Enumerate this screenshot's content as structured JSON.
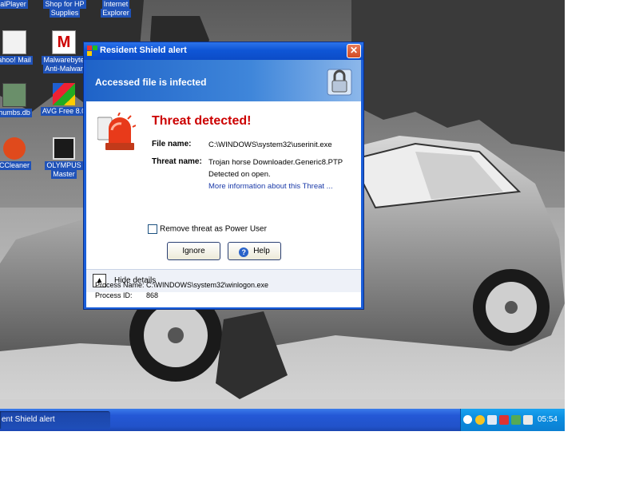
{
  "desktop": {
    "icons": [
      {
        "label": "ealPlayer"
      },
      {
        "label": "Shop for HP"
      },
      {
        "label": "Supplies"
      },
      {
        "label": "Internet"
      },
      {
        "label": "Explorer"
      },
      {
        "label": "ahoo! Mail"
      },
      {
        "label": "Malwarebyte"
      },
      {
        "label": "Anti-Malwar"
      },
      {
        "label": "humbs.db"
      },
      {
        "label": "AVG Free 8.0"
      },
      {
        "label": "CCleaner"
      },
      {
        "label": "OLYMPUS"
      },
      {
        "label": "Master"
      }
    ]
  },
  "taskbar": {
    "task_label": "ent Shield alert",
    "clock": "05:54"
  },
  "dialog": {
    "title": "Resident Shield alert",
    "banner": "Accessed file is infected",
    "threat_title": "Threat detected!",
    "file_name_label": "File name:",
    "file_name_value": "C:\\WINDOWS\\system32\\userinit.exe",
    "threat_name_label": "Threat name:",
    "threat_name_value": "Trojan horse Downloader.Generic8.PTP",
    "detected_text": "Detected on open.",
    "more_info_link": "More information about this Threat ...",
    "remove_checkbox_label": "Remove threat as Power User",
    "ignore_button": "Ignore",
    "help_button": "Help",
    "hide_details": "Hide details",
    "process_name_label": "Process Name:",
    "process_name_value": "C:\\WINDOWS\\system32\\winlogon.exe",
    "process_id_label": "Process ID:",
    "process_id_value": "868"
  },
  "colors": {
    "taskbar_blue": "#2458d6",
    "tray_blue": "#0c8ee0",
    "threat_red": "#cc0000",
    "link_blue": "#1a3aa8"
  }
}
